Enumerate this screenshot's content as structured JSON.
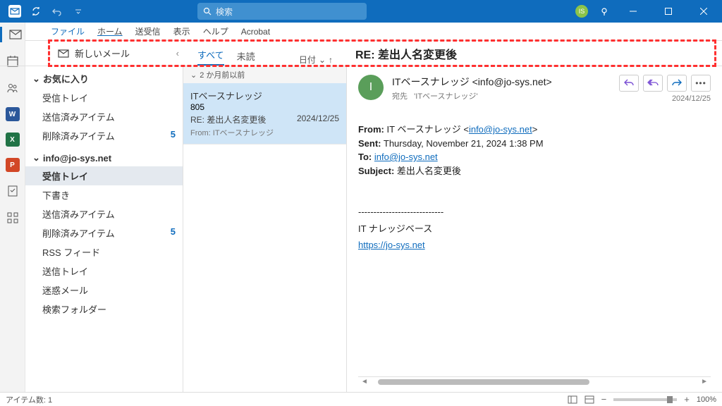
{
  "titlebar": {
    "search_placeholder": "検索"
  },
  "menu": {
    "file": "ファイル",
    "home": "ホーム",
    "sendreceive": "送受信",
    "view": "表示",
    "help": "ヘルプ",
    "acrobat": "Acrobat"
  },
  "ribbon": {
    "new_mail": "新しいメール",
    "tab_all": "すべて",
    "tab_unread": "未読",
    "sort_label": "日付"
  },
  "subject_header": "RE: 差出人名変更後",
  "folders": {
    "favorites": "お気に入り",
    "fav_items": [
      {
        "label": "受信トレイ",
        "count": ""
      },
      {
        "label": "送信済みアイテム",
        "count": ""
      },
      {
        "label": "削除済みアイテム",
        "count": "5"
      }
    ],
    "account": "info@jo-sys.net",
    "acct_items": [
      {
        "label": "受信トレイ",
        "count": ""
      },
      {
        "label": "下書き",
        "count": ""
      },
      {
        "label": "送信済みアイテム",
        "count": ""
      },
      {
        "label": "削除済みアイテム",
        "count": "5"
      },
      {
        "label": "RSS フィード",
        "count": ""
      },
      {
        "label": "送信トレイ",
        "count": ""
      },
      {
        "label": "迷惑メール",
        "count": ""
      },
      {
        "label": "検索フォルダー",
        "count": ""
      }
    ]
  },
  "msglist": {
    "group": "2 か月前以前",
    "item": {
      "from": "ITベースナレッジ",
      "subject": "RE: 差出人名変更後",
      "date": "2024/12/25",
      "meta": "From: ITベースナレッジ"
    }
  },
  "reading": {
    "sender": "ITベースナレッジ <info@jo-sys.net>",
    "to_label": "宛先",
    "to_value": "'ITベースナレッジ'",
    "date": "2024/12/25",
    "body": {
      "from_label": "From:",
      "from_value": "IT ベースナレッジ <",
      "from_email": "info@jo-sys.net",
      "sent_label": "Sent:",
      "sent_value": "Thursday, November 21, 2024 1:38 PM",
      "to_label": "To:",
      "to_email": "info@jo-sys.net",
      "subject_label": "Subject:",
      "subject_value": "差出人名変更後",
      "divider": "----------------------------",
      "sig_name": "IT ナレッジベース",
      "sig_url": "https://jo-sys.net"
    }
  },
  "statusbar": {
    "item_count": "アイテム数: 1",
    "zoom": "100%"
  }
}
